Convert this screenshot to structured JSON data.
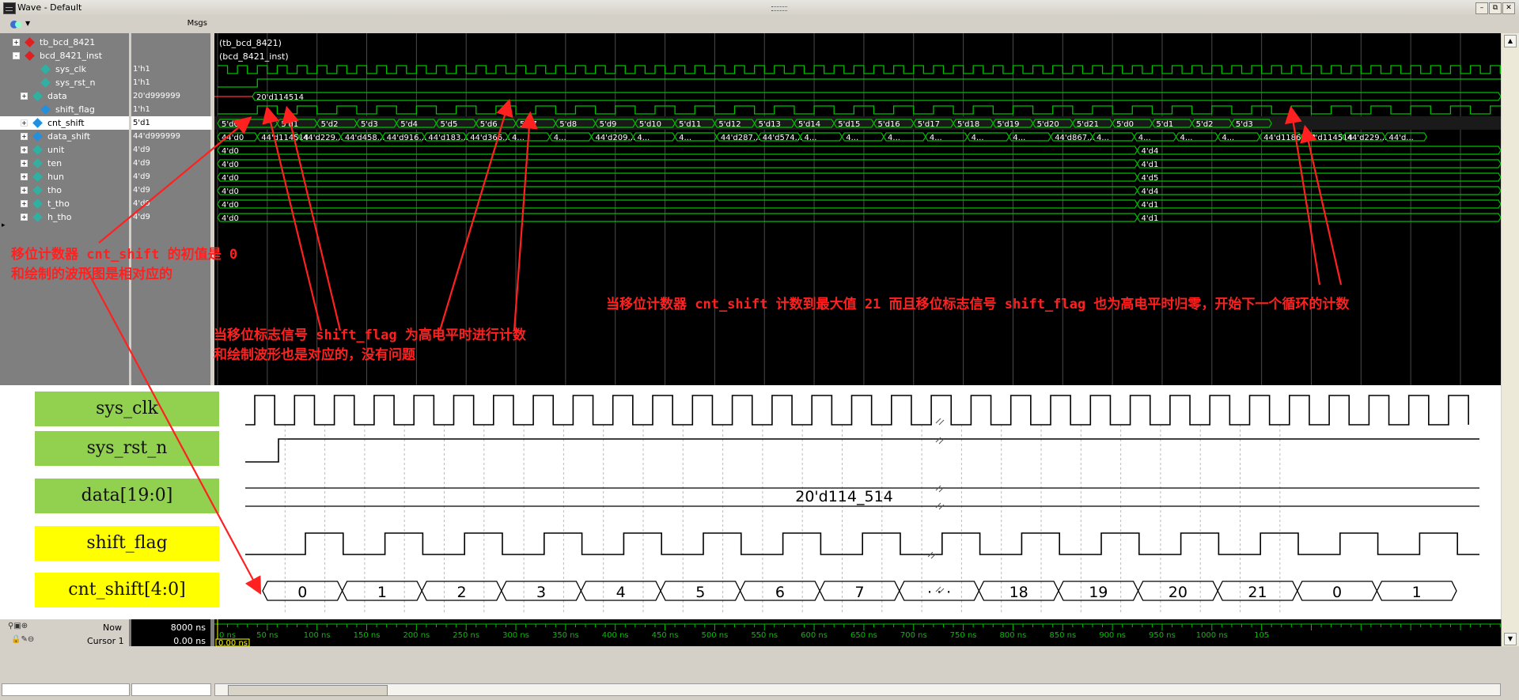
{
  "window": {
    "title": "Wave - Default"
  },
  "sig_header": {
    "msgs": "Msgs"
  },
  "signals": [
    {
      "name": "tb_bcd_8421",
      "value": "",
      "indent": 0,
      "expander": "+",
      "icon": "red"
    },
    {
      "name": "bcd_8421_inst",
      "value": "",
      "indent": 0,
      "expander": "-",
      "icon": "red"
    },
    {
      "name": "sys_clk",
      "value": "1'h1",
      "indent": 2,
      "expander": "",
      "icon": "teal"
    },
    {
      "name": "sys_rst_n",
      "value": "1'h1",
      "indent": 2,
      "expander": "",
      "icon": "teal"
    },
    {
      "name": "data",
      "value": "20'd999999",
      "indent": 1,
      "expander": "+",
      "icon": "teal"
    },
    {
      "name": "shift_flag",
      "value": "1'h1",
      "indent": 2,
      "expander": "",
      "icon": "blue"
    },
    {
      "name": "cnt_shift",
      "value": "5'd1",
      "indent": 1,
      "expander": "+",
      "icon": "blue",
      "selected": true
    },
    {
      "name": "data_shift",
      "value": "44'd999999",
      "indent": 1,
      "expander": "+",
      "icon": "blue"
    },
    {
      "name": "unit",
      "value": "4'd9",
      "indent": 1,
      "expander": "+",
      "icon": "teal"
    },
    {
      "name": "ten",
      "value": "4'd9",
      "indent": 1,
      "expander": "+",
      "icon": "teal"
    },
    {
      "name": "hun",
      "value": "4'd9",
      "indent": 1,
      "expander": "+",
      "icon": "teal"
    },
    {
      "name": "tho",
      "value": "4'd9",
      "indent": 1,
      "expander": "+",
      "icon": "teal"
    },
    {
      "name": "t_tho",
      "value": "4'd9",
      "indent": 1,
      "expander": "+",
      "icon": "teal"
    },
    {
      "name": "h_tho",
      "value": "4'd9",
      "indent": 1,
      "expander": "+",
      "icon": "teal"
    }
  ],
  "wave": {
    "group1": "tb_bcd_8421",
    "group2": "bcd_8421_inst",
    "data_val": "20'd114514",
    "cnt_values": [
      "5'd0",
      "5'd1",
      "5'd2",
      "5'd3",
      "5'd4",
      "5'd5",
      "5'd6",
      "5'd7",
      "5'd8",
      "5'd9",
      "5'd10",
      "5'd11",
      "5'd12",
      "5'd13",
      "5'd14",
      "5'd15",
      "5'd16",
      "5'd17",
      "5'd18",
      "5'd19",
      "5'd20",
      "5'd21",
      "5'd0",
      "5'd1",
      "5'd2",
      "5'd3"
    ],
    "data_shift_values": [
      "44'd0",
      "44'd114514",
      "44'd229...",
      "44'd458...",
      "44'd916...",
      "44'd183...",
      "44'd366...",
      "4...",
      "4...",
      "44'd209...",
      "4...",
      "4...",
      "44'd287...",
      "44'd574...",
      "4...",
      "4...",
      "4...",
      "4...",
      "4...",
      "4...",
      "44'd867...",
      "4...",
      "4...",
      "4...",
      "4...",
      "44'd1186773",
      "44'd114514",
      "44'd229...",
      "44'd..."
    ],
    "bcd_rows": [
      {
        "init": "4'd0",
        "final": "4'd4"
      },
      {
        "init": "4'd0",
        "final": "4'd1"
      },
      {
        "init": "4'd0",
        "final": "4'd5"
      },
      {
        "init": "4'd0",
        "final": "4'd4"
      },
      {
        "init": "4'd0",
        "final": "4'd1"
      },
      {
        "init": "4'd0",
        "final": "4'd1"
      }
    ]
  },
  "annotations": {
    "a1_line1": "移位计数器 cnt_shift 的初值是 0",
    "a1_line2": "和绘制的波形图是相对应的",
    "a2_line1": "当移位标志信号 shift_flag 为高电平时进行计数",
    "a2_line2": "和绘制波形也是对应的，没有问题",
    "a3": "当移位计数器 cnt_shift 计数到最大值 21 而且移位标志信号 shift_flag 也为高电平时归零，开始下一个循环的计数"
  },
  "diagram": {
    "labels": [
      {
        "text": "sys_clk",
        "color": "#92d050"
      },
      {
        "text": "sys_rst_n",
        "color": "#92d050"
      },
      {
        "text": "data[19:0]",
        "color": "#92d050"
      },
      {
        "text": "shift_flag",
        "color": "#ffff00"
      },
      {
        "text": "cnt_shift[4:0]",
        "color": "#ffff00"
      }
    ],
    "data_text": "20'd114_514",
    "cnt_texts": [
      "0",
      "1",
      "2",
      "3",
      "4",
      "5",
      "6",
      "7",
      "· · ·",
      "18",
      "19",
      "20",
      "21",
      "0",
      "1"
    ]
  },
  "cursor": {
    "now_label": "Now",
    "now_value": "8000 ns",
    "cursor_label": "Cursor 1",
    "cursor_value": "0.00 ns",
    "cursor_flag": "0.00 ns",
    "ticks": [
      "0 ns",
      "50 ns",
      "100 ns",
      "150 ns",
      "200 ns",
      "250 ns",
      "300 ns",
      "350 ns",
      "400 ns",
      "450 ns",
      "500 ns",
      "550 ns",
      "600 ns",
      "650 ns",
      "700 ns",
      "750 ns",
      "800 ns",
      "850 ns",
      "900 ns",
      "950 ns",
      "1000 ns",
      "105"
    ]
  },
  "colors": {
    "wave": "#00c000",
    "arrow": "#ff2020",
    "selected": "#ffffff"
  }
}
